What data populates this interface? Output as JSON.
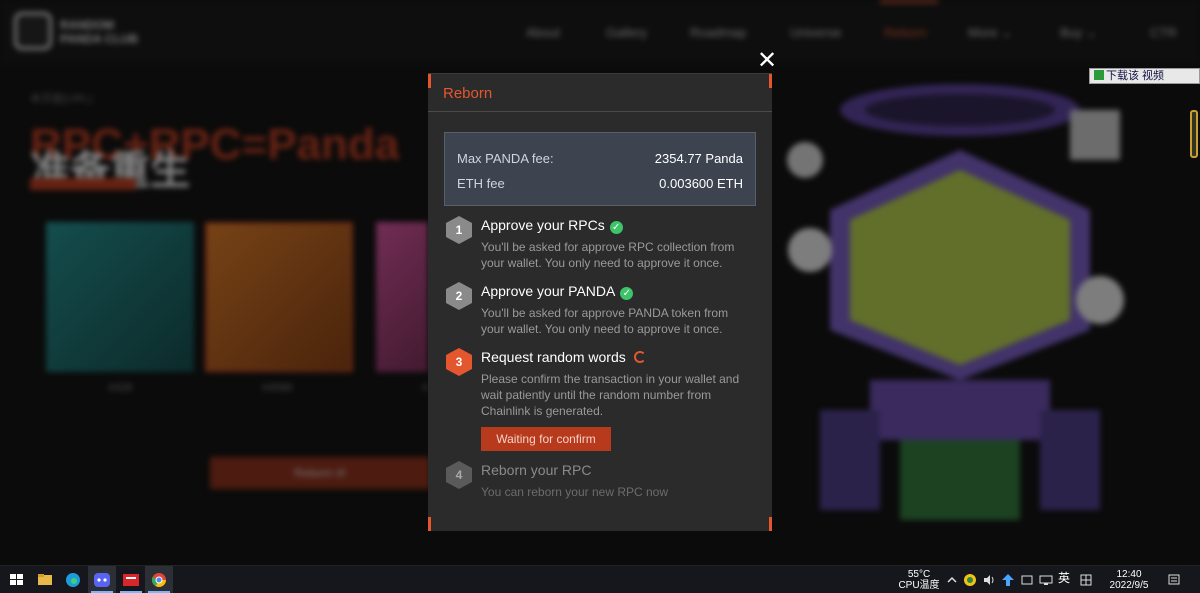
{
  "site": {
    "logo_line1": "RANDOM",
    "logo_line2": "PANDA CLUB",
    "nav": [
      "About",
      "Gallery",
      "Roadmap",
      "Universe",
      "Reborn",
      "More ⌄",
      "Buy ⌄",
      "CTR"
    ],
    "active_nav": "Reborn",
    "breadcrumb": "本页面(URL)",
    "hero_title": "RPC+RPC=Panda",
    "hero_subtitle": "准备重生",
    "card_labels": [
      "#428",
      "#4586",
      "#"
    ],
    "bg_button": "Reborn it!"
  },
  "widget": {
    "download_label": "下载该 视频"
  },
  "modal": {
    "title": "Reborn",
    "close_glyph": "✕",
    "fees": [
      {
        "label": "Max PANDA fee:",
        "value": "2354.77 Panda"
      },
      {
        "label": "ETH fee",
        "value": "0.003600 ETH"
      }
    ],
    "steps": [
      {
        "num": "1",
        "title": "Approve your RPCs",
        "status": "done",
        "desc": "You'll be asked for approve RPC collection from your wallet. You only need to approve it once."
      },
      {
        "num": "2",
        "title": "Approve your PANDA",
        "status": "done",
        "desc": "You'll be asked for approve PANDA token from your wallet. You only need to approve it once."
      },
      {
        "num": "3",
        "title": "Request random words",
        "status": "pending",
        "desc": "Please confirm the transaction in your wallet and wait patiently until the random number from Chainlink is generated.",
        "button": "Waiting for confirm"
      },
      {
        "num": "4",
        "title": "Reborn your RPC",
        "status": "todo",
        "desc": "You can reborn your new RPC now"
      }
    ],
    "check_glyph": "✓"
  },
  "taskbar": {
    "cpu_temp": "55°C",
    "cpu_label": "CPU温度",
    "ime": "英",
    "time": "12:40",
    "date": "2022/9/5"
  },
  "colors": {
    "accent": "#e4572e",
    "done": "#3cc469",
    "step_inactive": "#8a8a8a"
  }
}
